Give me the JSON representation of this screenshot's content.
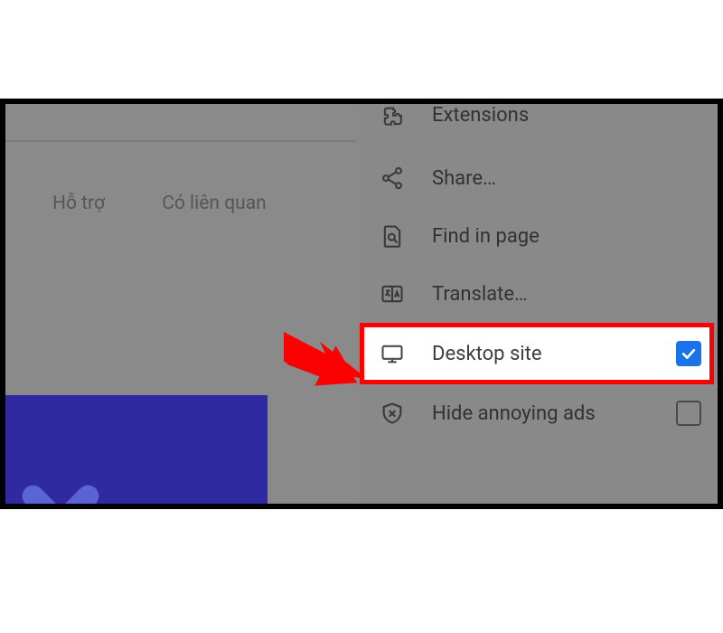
{
  "background": {
    "tabs": {
      "support": "Hỗ trợ",
      "related": "Có liên quan"
    }
  },
  "menu": {
    "extensions": "Extensions",
    "share": "Share…",
    "find_in_page": "Find in page",
    "translate": "Translate…",
    "desktop_site": "Desktop site",
    "hide_ads": "Hide annoying ads"
  },
  "state": {
    "desktop_site_checked": true,
    "hide_ads_checked": false
  },
  "annotation": {
    "highlight_color": "#fb0101"
  }
}
